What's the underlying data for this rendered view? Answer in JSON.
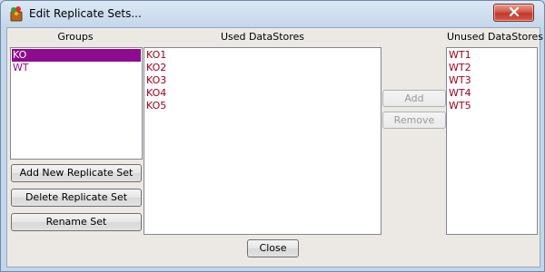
{
  "window": {
    "title": "Edit Replicate Sets..."
  },
  "groups": {
    "label": "Groups",
    "items": [
      {
        "label": "KO",
        "selected": true
      },
      {
        "label": "WT",
        "selected": false
      }
    ],
    "selected_color": "#8e0a8e"
  },
  "buttons": {
    "add_new": "Add New Replicate Set",
    "delete": "Delete Replicate Set",
    "rename": "Rename Set",
    "add": "Add",
    "remove": "Remove",
    "close": "Close"
  },
  "used": {
    "label": "Used DataStores",
    "items": [
      "KO1",
      "KO2",
      "KO3",
      "KO4",
      "KO5"
    ]
  },
  "unused": {
    "label": "Unused DataStores",
    "items": [
      "WT1",
      "WT2",
      "WT3",
      "WT4",
      "WT5"
    ]
  },
  "colors": {
    "datastore_text": "#a0001e",
    "group_text": "#8e0a8e"
  },
  "icons": {
    "app": "replicate-app-icon",
    "close": "close-icon"
  }
}
